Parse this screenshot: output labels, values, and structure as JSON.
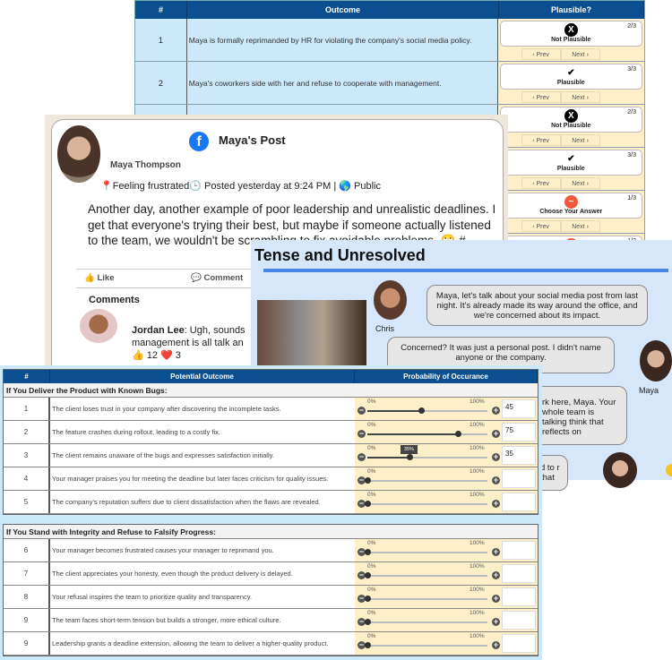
{
  "plausibility_table": {
    "headers": [
      "#",
      "Outcome",
      "Plausible?"
    ],
    "prev_label": "Prev",
    "next_label": "Next",
    "rows": [
      {
        "n": "1",
        "outcome": "Maya is formally reprimanded by HR for violating the company's social media policy.",
        "answer": "Not Plausible",
        "icon": "x-circle-icon",
        "count": "2/3"
      },
      {
        "n": "2",
        "outcome": "Maya's coworkers side with her and refuse to cooperate with management.",
        "answer": "Plausible",
        "icon": "checkmark-icon",
        "count": "3/3"
      },
      {
        "n": "",
        "outcome": "",
        "answer": "Not Plausible",
        "icon": "x-circle-icon",
        "count": "2/3"
      },
      {
        "n": "",
        "outcome": "",
        "answer": "Plausible",
        "icon": "checkmark-icon",
        "count": "3/3"
      },
      {
        "n": "",
        "outcome": "",
        "answer": "Choose Your Answer",
        "icon": "minus-circle-icon",
        "count": "1/3"
      },
      {
        "n": "",
        "outcome": "",
        "answer": "",
        "icon": "minus-circle-icon",
        "count": "1/3"
      }
    ]
  },
  "post": {
    "title": "Maya's  Post",
    "author": "Maya Thompson",
    "meta": "📍Feeling frustrated🕒 Posted yesterday at 9:24 PM | 🌎 Public",
    "body": "Another day, another example of poor leadership and unrealistic deadlines. I get that everyone's trying their best, but maybe if someone actually listened to the team, we wouldn't be scrambling to fix avoidable problems. 🙄 #",
    "like_label": "👍 Like",
    "comment_label": "💬 Comment",
    "comments_heading": "Comments",
    "comment": {
      "author": "Jordan Lee",
      "text": ": Ugh, sounds",
      "text2": "management is all talk an",
      "reactions": "👍 12 ❤️ 3"
    }
  },
  "chat": {
    "title": "Tense and Unresolved",
    "messages": [
      {
        "speaker": "Chris",
        "text": "Maya, let's talk about your social media post from last night. It's already made its way around the office, and we're concerned about its impact."
      },
      {
        "speaker": "Maya",
        "text": "Concerned? It was just a personal post. I didn't name anyone or the company."
      },
      {
        "speaker": "",
        "text": "rk here, Maya. Your whole team is talking think that reflects on"
      },
      {
        "speaker": "",
        "text": "d to r that"
      }
    ]
  },
  "probability_table": {
    "headers": [
      "#",
      "Potential Outcome",
      "Probability of Occurance"
    ],
    "min_label": "0%",
    "max_label": "100%",
    "sections": [
      {
        "title": "If You Deliver the Product with Known Bugs:",
        "rows": [
          {
            "n": "1",
            "outcome": "The client loses trust in your company after discovering the incomplete tasks.",
            "value": "45",
            "pct": 45
          },
          {
            "n": "2",
            "outcome": "The feature crashes during rollout, leading to a costly fix.",
            "value": "75",
            "pct": 75
          },
          {
            "n": "3",
            "outcome": "The client remains unaware of the bugs and expresses satisfaction initially.",
            "value": "35",
            "pct": 35,
            "tooltip": "35%"
          },
          {
            "n": "4",
            "outcome": "Your manager praises you for meeting the deadline but later faces criticism for quality issues.",
            "value": "",
            "pct": 0
          },
          {
            "n": "5",
            "outcome": "The company's reputation suffers due to client dissatisfaction when the flaws are revealed.",
            "value": "",
            "pct": 0
          }
        ]
      },
      {
        "title": "If You Stand with Integrity and Refuse to Falsify Progress:",
        "rows": [
          {
            "n": "6",
            "outcome": "Your manager becomes frustrated causes your manager to reprimand you.",
            "value": "",
            "pct": 0
          },
          {
            "n": "7",
            "outcome": "The client appreciates your honesty, even though the product delivery is delayed.",
            "value": "",
            "pct": 0
          },
          {
            "n": "8",
            "outcome": "Your refusal inspires the team to prioritize quality and transparency.",
            "value": "",
            "pct": 0
          },
          {
            "n": "9",
            "outcome": "The team faces short-term tension but builds a stronger, more ethical culture.",
            "value": "",
            "pct": 0
          },
          {
            "n": "9",
            "outcome": "Leadership grants a deadline extension, allowing the team to deliver a higher-quality product.",
            "value": "",
            "pct": 0
          }
        ]
      }
    ]
  },
  "colors": {
    "header_blue": "#0b4f91",
    "panel_blue": "#cce8fb",
    "slider_yellow": "#fdf0c8",
    "chat_bg": "#d6e6fb",
    "facebook_blue": "#1877f2"
  }
}
